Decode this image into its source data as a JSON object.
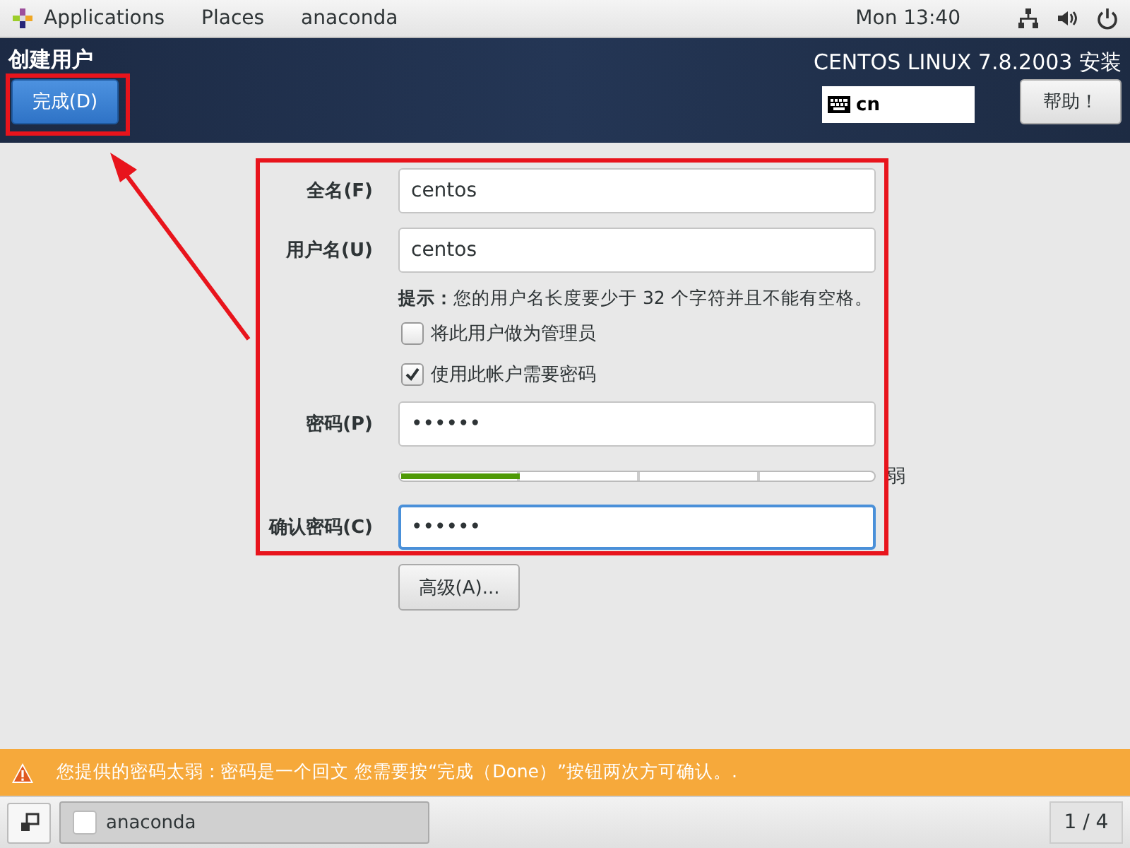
{
  "top_bar": {
    "menus": [
      "Applications",
      "Places",
      "anaconda"
    ],
    "clock": "Mon 13:40"
  },
  "header": {
    "title": "创建用户",
    "done_button": "完成(D)",
    "product": "CENTOS LINUX 7.8.2003 安装",
    "keyboard_layout": "cn",
    "help_button": "帮助！"
  },
  "form": {
    "full_name": {
      "label": "全名(F)",
      "value": "centos"
    },
    "username": {
      "label": "用户名(U)",
      "value": "centos"
    },
    "hint": "**提示：**您的用户名长度要少于 32 个字符并且不能有空格。",
    "options": [
      {
        "label": "将此用户做为管理员",
        "checked": false
      },
      {
        "label": "使用此帐户需要密码",
        "checked": true
      }
    ],
    "password": {
      "label": "密码(P)",
      "value": "••••••"
    },
    "strength": {
      "level": 0.25,
      "reading": "弱"
    },
    "confirm_password": {
      "label": "确认密码(C)",
      "value": "••••••",
      "focused": true
    },
    "advanced_button": "高级(A)..."
  },
  "warning": "您提供的密码太弱 : 密码是一个回文 您需要按“完成（Done）”按钮两次方可确认。.",
  "taskbar": {
    "window": "anaconda",
    "workspace": "1 / 4"
  }
}
